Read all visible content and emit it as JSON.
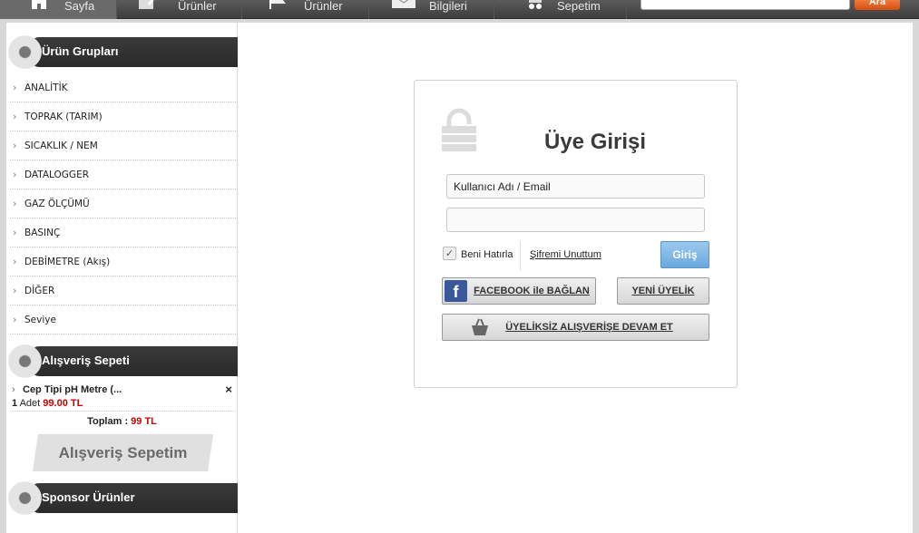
{
  "nav": {
    "items": [
      {
        "label": "Sayfa",
        "icon": "home-icon",
        "active": true
      },
      {
        "label": "Ürünler",
        "icon": "pencil-icon",
        "active": false
      },
      {
        "label": "Ürünler",
        "icon": "flag-icon",
        "active": false
      },
      {
        "label": "Bilgileri",
        "icon": "envelope-icon",
        "active": false
      },
      {
        "label": "Sepetim",
        "icon": "cart-icon",
        "active": false
      }
    ],
    "search_placeholder": "",
    "search_button": "Ara"
  },
  "sidebar": {
    "categories_title": "Ürün Grupları",
    "categories": [
      "ANALİTİK",
      "TOPRAK (TARIM)",
      "SICAKLIK / NEM",
      "DATALOGGER",
      "GAZ ÖLÇÜMÜ",
      "BASINÇ",
      "DEBİMETRE (Akış)",
      "DİĞER",
      "Seviye"
    ],
    "cart_title": "Alışveriş Sepeti",
    "cart_item": {
      "name": "Cep Tipi pH Metre (...",
      "qty": "1",
      "qty_unit": "Adet",
      "price": "99.00 TL",
      "remove": "×"
    },
    "cart_total_label": "Toplam :",
    "cart_total_value": "99 TL",
    "cart_button": "Alışveriş Sepetim",
    "sponsor_title": "Sponsor Ürünler"
  },
  "login": {
    "title": "Üye Girişi",
    "username_placeholder": "Kullanıcı Adı / Email",
    "password_placeholder": "",
    "remember_label": "Beni Hatırla",
    "remember_checked": true,
    "forgot_label": "Şifremi Unuttum",
    "submit_label": "Giriş",
    "facebook_label": "FACEBOOK ile BAĞLAN",
    "register_label": "YENİ ÜYELİK",
    "guest_label": "ÜYELİKSİZ ALIŞVERİŞE DEVAM ET",
    "colors": {
      "submit": "#7ab3e3",
      "facebook": "#3b5998"
    }
  }
}
